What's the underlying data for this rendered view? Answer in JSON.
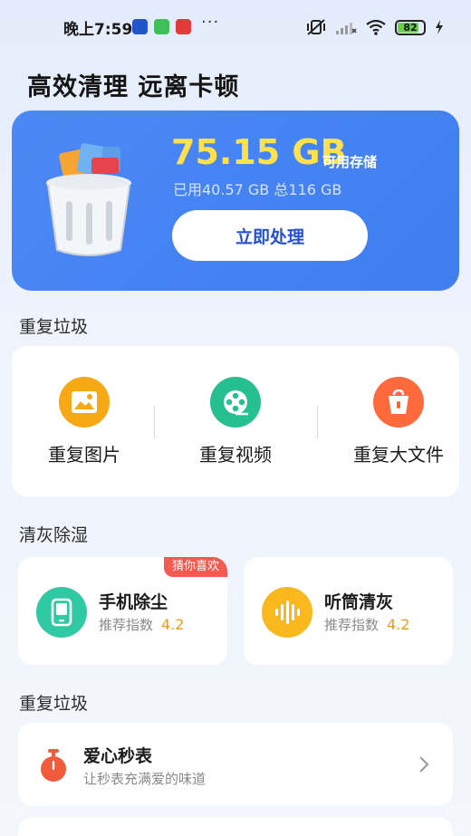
{
  "status_bar": {
    "time": "晚上7:59",
    "more": "···",
    "battery_level": "82",
    "battery_fraction": 0.82,
    "icons": [
      "app-notify-icon-1",
      "app-notify-icon-2",
      "app-notify-icon-3",
      "mute-vibrate-icon",
      "signal-icon",
      "wifi-icon",
      "battery-icon",
      "charging-icon"
    ]
  },
  "page": {
    "title": "高效清理 远离卡顿"
  },
  "storage": {
    "free": "75.15 GB",
    "free_label": "可用存储",
    "usage": "已用40.57 GB 总116 GB",
    "action": "立即处理"
  },
  "duplicate_section": {
    "title": "重复垃圾",
    "items": [
      {
        "label": "重复图片",
        "icon": "image-icon",
        "color": "#f7a815"
      },
      {
        "label": "重复视频",
        "icon": "film-reel-icon",
        "color": "#25c08e"
      },
      {
        "label": "重复大文件",
        "icon": "trash-bin-icon",
        "color": "#ff6a3d"
      }
    ]
  },
  "dust_section": {
    "title": "清灰除湿",
    "tools": [
      {
        "name": "手机除尘",
        "score_label": "推荐指数",
        "score": "4.2",
        "badge": "猜你喜欢",
        "icon": "phone-icon",
        "color": "#2fc9a4"
      },
      {
        "name": "听筒清灰",
        "score_label": "推荐指数",
        "score": "4.2",
        "badge": "",
        "icon": "sound-wave-icon",
        "color": "#f9b81e"
      }
    ]
  },
  "extra_section": {
    "title": "重复垃圾",
    "items": [
      {
        "title": "爱心秒表",
        "subtitle": "让秒表充满爱的味道",
        "icon": "stopwatch-icon",
        "color": "#f15a3b"
      }
    ]
  },
  "colors": {
    "hero_bg": "#4585f3",
    "hero_highlight": "#ffe14d",
    "button_text": "#2450d8",
    "score": "#f29a1c",
    "badge": "#f25a52"
  }
}
